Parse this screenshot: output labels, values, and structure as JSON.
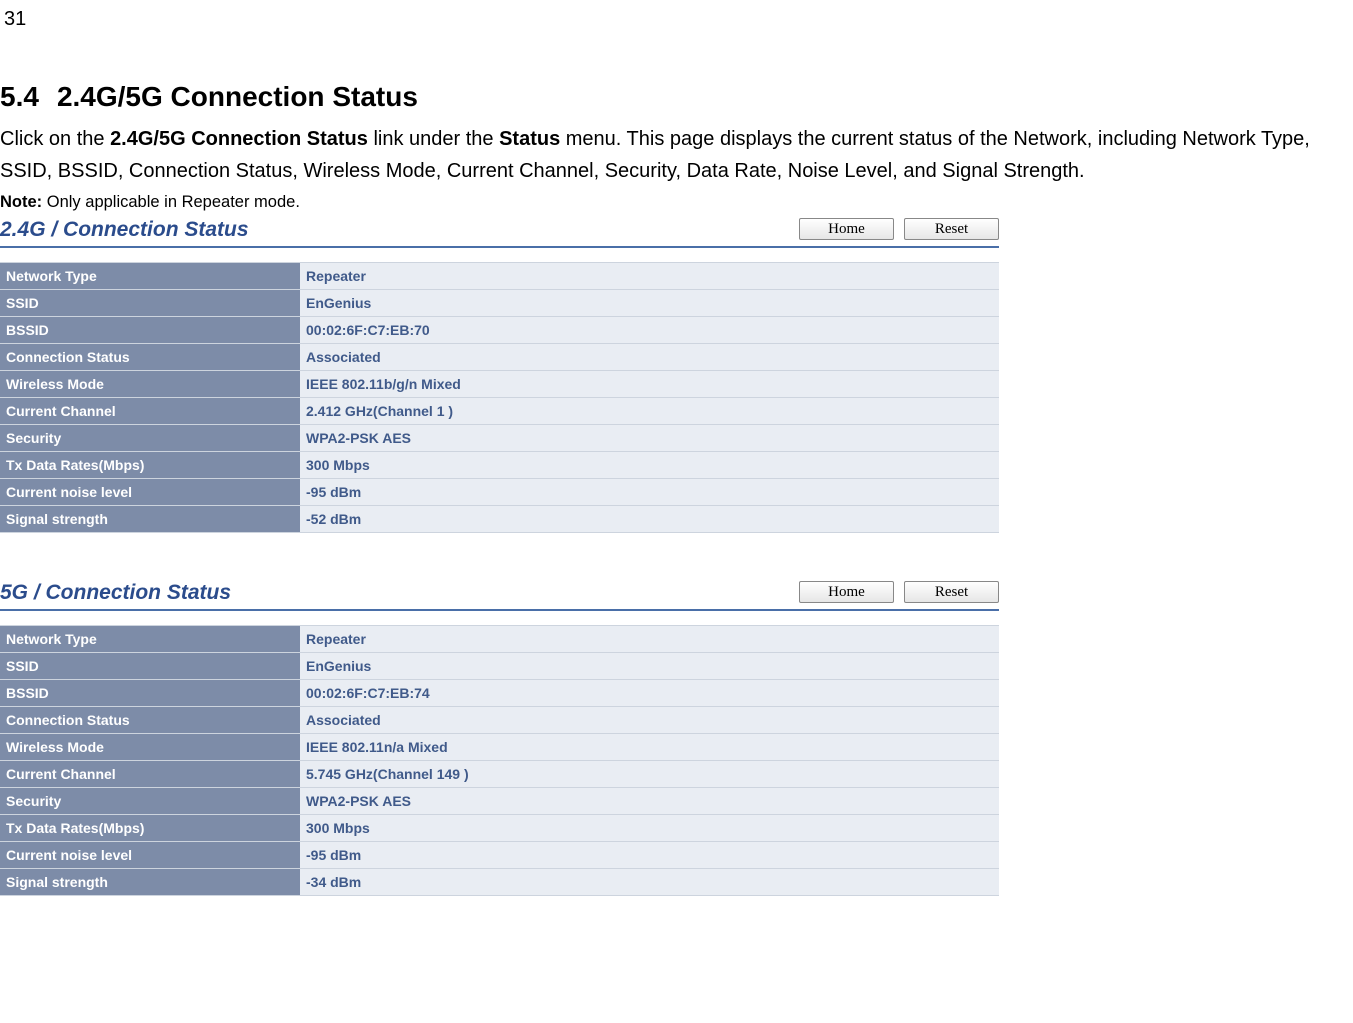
{
  "page_number": "31",
  "section": {
    "num": "5.4",
    "title": "2.4G/5G Connection Status"
  },
  "intro": {
    "pre": "Click on the ",
    "b1": "2.4G/5G Connection Status",
    "mid": " link under the ",
    "b2": "Status",
    "post": " menu. This page displays the current status of the Network, including Network Type, SSID, BSSID, Connection Status, Wireless Mode, Current Channel, Security, Data Rate, Noise Level, and Signal Strength."
  },
  "note": {
    "label": "Note:",
    "text": " Only applicable in Repeater mode."
  },
  "buttons": {
    "home": "Home",
    "reset": "Reset"
  },
  "panels": [
    {
      "title": "2.4G / Connection Status",
      "rows": [
        {
          "k": "Network Type",
          "v": "Repeater"
        },
        {
          "k": "SSID",
          "v": "EnGenius"
        },
        {
          "k": "BSSID",
          "v": "00:02:6F:C7:EB:70"
        },
        {
          "k": "Connection Status",
          "v": "Associated"
        },
        {
          "k": "Wireless Mode",
          "v": "IEEE 802.11b/g/n Mixed"
        },
        {
          "k": "Current Channel",
          "v": "2.412 GHz(Channel 1 )"
        },
        {
          "k": "Security",
          "v": "WPA2-PSK AES"
        },
        {
          "k": "Tx Data Rates(Mbps)",
          "v": "300 Mbps"
        },
        {
          "k": "Current noise level",
          "v": "-95 dBm"
        },
        {
          "k": "Signal strength",
          "v": "-52 dBm"
        }
      ]
    },
    {
      "title": "5G / Connection Status",
      "rows": [
        {
          "k": "Network Type",
          "v": "Repeater"
        },
        {
          "k": "SSID",
          "v": "EnGenius"
        },
        {
          "k": "BSSID",
          "v": "00:02:6F:C7:EB:74"
        },
        {
          "k": "Connection Status",
          "v": "Associated"
        },
        {
          "k": "Wireless Mode",
          "v": "IEEE 802.11n/a Mixed"
        },
        {
          "k": "Current Channel",
          "v": "5.745 GHz(Channel 149 )"
        },
        {
          "k": "Security",
          "v": "WPA2-PSK AES"
        },
        {
          "k": "Tx Data Rates(Mbps)",
          "v": "300 Mbps"
        },
        {
          "k": "Current noise level",
          "v": "-95 dBm"
        },
        {
          "k": "Signal strength",
          "v": "-34 dBm"
        }
      ]
    }
  ]
}
